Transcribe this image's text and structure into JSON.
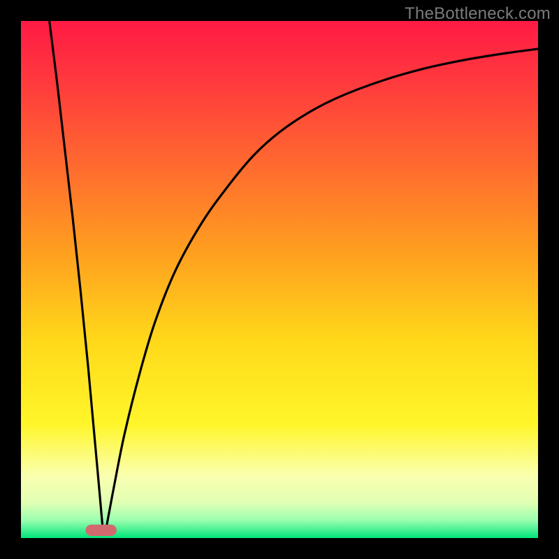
{
  "watermark": "TheBottleneck.com",
  "chart_data": {
    "type": "line",
    "title": "",
    "xlabel": "",
    "ylabel": "",
    "xlim": [
      0,
      100
    ],
    "ylim": [
      0,
      100
    ],
    "grid": false,
    "legend": false,
    "gradient_stops": [
      {
        "offset": 0.0,
        "color": "#ff1a44"
      },
      {
        "offset": 0.12,
        "color": "#ff3a3d"
      },
      {
        "offset": 0.28,
        "color": "#ff6a2f"
      },
      {
        "offset": 0.45,
        "color": "#ffa01f"
      },
      {
        "offset": 0.62,
        "color": "#ffd91a"
      },
      {
        "offset": 0.78,
        "color": "#fff62a"
      },
      {
        "offset": 0.88,
        "color": "#faffb0"
      },
      {
        "offset": 0.93,
        "color": "#e2ffb4"
      },
      {
        "offset": 0.965,
        "color": "#9dffb0"
      },
      {
        "offset": 1.0,
        "color": "#00e57a"
      }
    ],
    "marker": {
      "x": 15.5,
      "y": 1.5,
      "w": 6,
      "h": 2.2,
      "rx": 1.1,
      "fill": "#d16a6f"
    },
    "series": [
      {
        "name": "left-branch",
        "type": "line",
        "x": [
          5.5,
          7.0,
          8.5,
          10.0,
          11.5,
          13.0,
          14.0,
          15.0,
          15.8
        ],
        "values": [
          100,
          88,
          75,
          62,
          48,
          33,
          22,
          11,
          2.0
        ]
      },
      {
        "name": "right-branch",
        "type": "line",
        "x": [
          16.5,
          18,
          20,
          23,
          26,
          30,
          35,
          40,
          45,
          50,
          56,
          62,
          70,
          78,
          86,
          94,
          100
        ],
        "values": [
          2.0,
          10,
          20,
          32,
          42,
          52,
          61,
          68,
          74,
          78.5,
          82.5,
          85.5,
          88.5,
          90.8,
          92.5,
          93.8,
          94.6
        ]
      }
    ]
  }
}
